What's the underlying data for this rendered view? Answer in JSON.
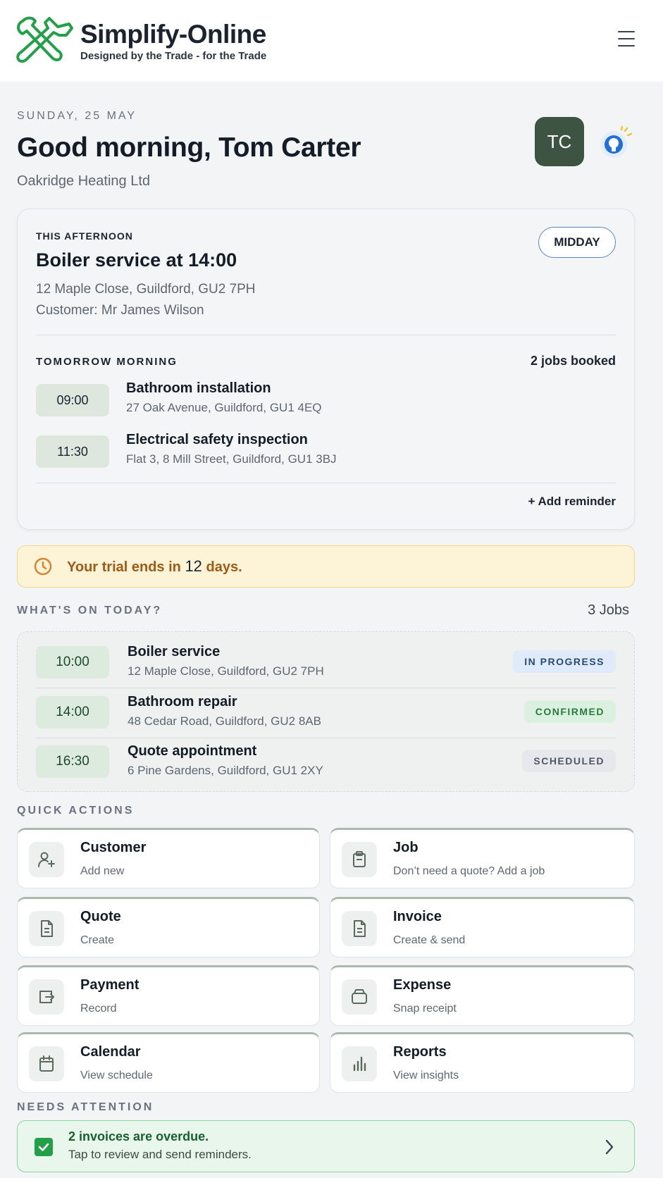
{
  "brand": {
    "name": "Simplify-Online",
    "tagline": "Designed by the Trade - for the Trade"
  },
  "colors": {
    "brand_green": "#22a047",
    "avatar_bg": "#3d5443",
    "trial_bg": "#fdf4d8",
    "trial_text": "#a05a14"
  },
  "greeting": {
    "date": "SUNDAY, 25 MAY",
    "title": "Good morning, Tom Carter",
    "company": "Oakridge Heating Ltd",
    "avatar_initials": "TC"
  },
  "next_job": {
    "label": "THIS AFTERNOON",
    "title": "Boiler service at 14:00",
    "address": "12 Maple Close, Guildford, GU2 7PH",
    "customer": "Customer: Mr James Wilson",
    "period_badge": "MIDDAY"
  },
  "tomorrow": {
    "label": "TOMORROW MORNING",
    "count": "2 jobs booked",
    "jobs": [
      {
        "time": "09:00",
        "title": "Bathroom installation",
        "address": "27 Oak Avenue, Guildford, GU1 4EQ"
      },
      {
        "time": "11:30",
        "title": "Electrical safety inspection",
        "address": "Flat 3, 8 Mill Street, Guildford, GU1 3BJ"
      }
    ],
    "add_reminder": "+ Add reminder"
  },
  "trial": {
    "prefix": "Your trial ends in",
    "days": "12",
    "suffix": "days."
  },
  "today": {
    "label": "WHAT'S ON TODAY?",
    "count": "3 Jobs",
    "jobs": [
      {
        "time": "10:00",
        "title": "Boiler service",
        "address": "12 Maple Close, Guildford, GU2 7PH",
        "status": "IN PROGRESS"
      },
      {
        "time": "14:00",
        "title": "Bathroom repair",
        "address": "48 Cedar Road, Guildford, GU2 8AB",
        "status": "CONFIRMED"
      },
      {
        "time": "16:30",
        "title": "Quote appointment",
        "address": "6 Pine Gardens, Guildford, GU1 2XY",
        "status": "SCHEDULED"
      }
    ]
  },
  "quick_actions": {
    "label": "QUICK ACTIONS",
    "items": [
      {
        "title": "Customer",
        "sub": "Add new",
        "icon": "add-user-icon"
      },
      {
        "title": "Job",
        "sub": "Don’t need a quote? Add a job",
        "icon": "clipboard-icon"
      },
      {
        "title": "Quote",
        "sub": "Create",
        "icon": "document-icon"
      },
      {
        "title": "Invoice",
        "sub": "Create & send",
        "icon": "document-icon"
      },
      {
        "title": "Payment",
        "sub": "Record",
        "icon": "payment-icon"
      },
      {
        "title": "Expense",
        "sub": "Snap receipt",
        "icon": "wallet-icon"
      },
      {
        "title": "Calendar",
        "sub": "View schedule",
        "icon": "calendar-icon"
      },
      {
        "title": "Reports",
        "sub": "View insights",
        "icon": "bar-chart-icon"
      }
    ]
  },
  "attention": {
    "label": "NEEDS ATTENTION",
    "title": "2 invoices are overdue.",
    "sub": "Tap to review and send reminders."
  }
}
